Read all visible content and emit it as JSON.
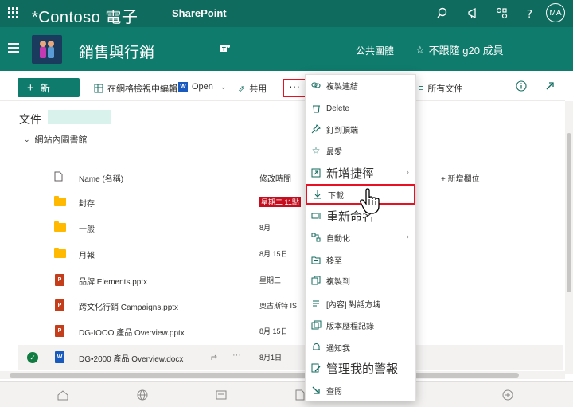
{
  "suitebar": {
    "brand": "*Contoso 電子",
    "app": "SharePoint",
    "avatar": "MA"
  },
  "site": {
    "title": "銷售與行銷",
    "public_group": "公共團體",
    "follow": "不跟隨 g20 成員"
  },
  "commands": {
    "new": "新",
    "grid_edit": "在網格檢視中編輯",
    "open": "Open",
    "share": "共用",
    "more": "···",
    "all_docs": "所有文件"
  },
  "library": {
    "title": "文件",
    "breadcrumb": "網站內圖書館",
    "col_name": "Name (名稱)",
    "col_modified": "修改時間",
    "col_add": "新增欄位",
    "rows": [
      {
        "name": "封存",
        "date": "星期二 11點",
        "type": "folder"
      },
      {
        "name": "一般",
        "date": "8月",
        "type": "folder"
      },
      {
        "name": "月報",
        "date": "8月 15日",
        "type": "folder"
      },
      {
        "name": "品牌 Elements.pptx",
        "date": "星期三",
        "type": "ppt"
      },
      {
        "name": "跨文化行銷 Campaigns.pptx",
        "date": "奧古斯特 IS",
        "type": "ppt"
      },
      {
        "name": "DG-IOOO 產品 Overview.pptx",
        "date": "8月 15日",
        "type": "ppt"
      },
      {
        "name": "DG•2000 產品 Overview.docx",
        "date": "8月1日",
        "type": "docx"
      }
    ]
  },
  "menu": {
    "items": [
      {
        "label": "複製連結",
        "icon": "link-icon"
      },
      {
        "label": "Delete",
        "icon": "trash-icon"
      },
      {
        "label": "釘到頂端",
        "icon": "pin-icon"
      },
      {
        "label": "最愛",
        "icon": "star-icon"
      },
      {
        "label": "新增捷徑",
        "icon": "shortcut-icon"
      },
      {
        "label": "下載",
        "icon": "download-icon"
      },
      {
        "label": "重新命名",
        "icon": "rename-icon"
      },
      {
        "label": "自動化",
        "icon": "automate-icon"
      },
      {
        "label": "移至",
        "icon": "move-icon"
      },
      {
        "label": "複製到",
        "icon": "copy-icon"
      },
      {
        "label": "[內容] 對話方塊",
        "icon": "info-icon"
      },
      {
        "label": "版本歷程記錄",
        "icon": "history-icon"
      },
      {
        "label": "通知我",
        "icon": "bell-icon"
      },
      {
        "label": "管理我的警報",
        "icon": "alert-icon"
      },
      {
        "label": "查閱",
        "icon": "checkout-icon"
      }
    ]
  }
}
